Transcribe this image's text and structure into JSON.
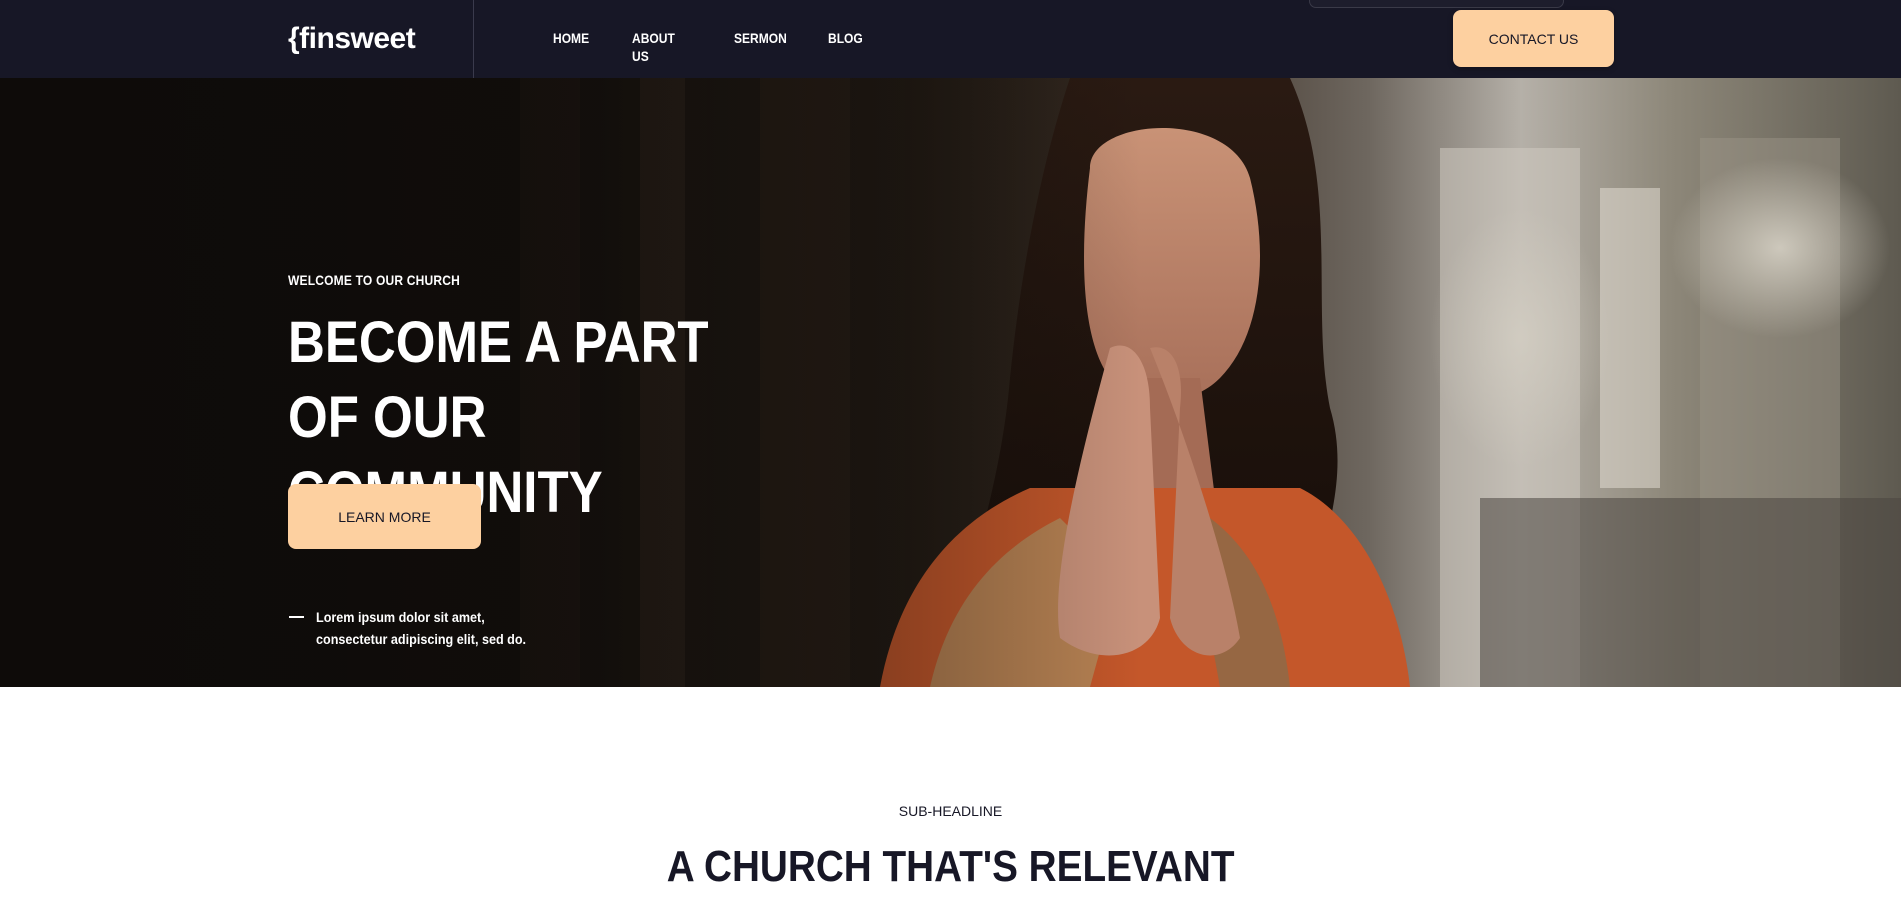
{
  "navbar": {
    "logo": "{finsweet",
    "links": [
      "HOME",
      "ABOUT US",
      "SERMON",
      "BLOG"
    ],
    "contact_label": "CONTACT US"
  },
  "hero": {
    "kicker": "WELCOME TO OUR CHURCH",
    "title": "BECOME A PART OF OUR COMMUNITY",
    "cta_label": "LEARN MORE",
    "note": "Lorem ipsum dolor sit amet, consectetur adipiscing elit, sed do."
  },
  "section": {
    "sub_headline": "SUB-HEADLINE",
    "title": "A CHURCH THAT'S RELEVANT"
  },
  "colors": {
    "navbar_bg": "#171726",
    "accent": "#fdd0a0",
    "text_dark": "#171726"
  },
  "icons": {
    "hero_photo": "woman-praying-image"
  }
}
